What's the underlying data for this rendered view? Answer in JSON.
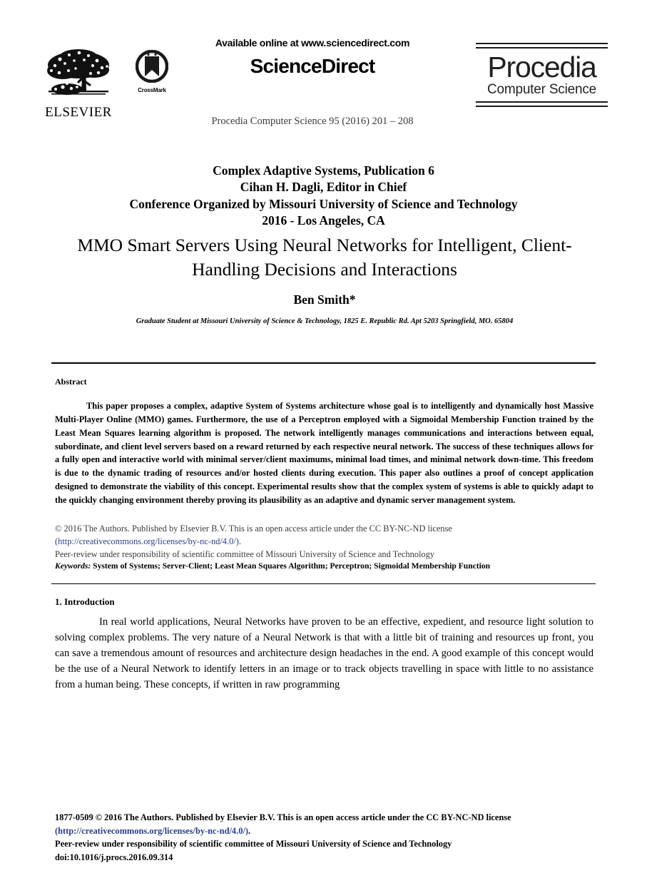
{
  "masthead": {
    "elsevier_wordmark": "ELSEVIER",
    "crossmark_label": "CrossMark",
    "available_online": "Available online at www.sciencedirect.com",
    "sciencedirect_wordmark": "ScienceDirect",
    "journal_reference": "Procedia Computer Science 95 (2016) 201 – 208",
    "procedia_title": "Procedia",
    "procedia_subtitle": "Computer Science"
  },
  "conference": {
    "line1": "Complex Adaptive Systems, Publication 6",
    "line2": "Cihan H. Dagli, Editor in Chief",
    "line3": "Conference Organized by Missouri University of Science and Technology",
    "line4": "2016 - Los Angeles, CA"
  },
  "article": {
    "title": "MMO Smart Servers Using Neural Networks for Intelligent, Client-Handling Decisions and Interactions",
    "author": "Ben Smith*",
    "affiliation": "Graduate Student at Missouri University of Science & Technology, 1825 E. Republic Rd. Apt 5203 Springfield, MO. 65804"
  },
  "abstract": {
    "heading": "Abstract",
    "body": "This paper proposes a complex, adaptive System of Systems architecture whose goal is to intelligently and dynamically host Massive Multi-Player Online (MMO) games. Furthermore, the use of a Perceptron employed with a Sigmoidal Membership Function trained by the Least Mean Squares learning algorithm is proposed. The network intelligently manages communications and interactions between equal, subordinate, and client level servers based on a reward returned by each respective neural network. The success of these techniques allows for a fully open and interactive world with minimal server/client maximums, minimal load times, and minimal network down-time. This freedom is due to the dynamic trading of resources and/or hosted clients during execution. This paper also outlines a proof of concept application designed to demonstrate the viability of this concept. Experimental results show that the complex system of systems is able to quickly adapt to the quickly changing environment thereby proving its plausibility as an adaptive and dynamic server management system."
  },
  "license": {
    "line1": "© 2016 The Authors. Published by Elsevier B.V. This is an open access article under the CC BY-NC-ND license",
    "url": "(http://creativecommons.org/licenses/by-nc-nd/4.0/)",
    "url_suffix": ".",
    "peer_review": "Peer-review under responsibility of scientific committee of Missouri University of Science and Technology"
  },
  "keywords": {
    "label": "Keywords:",
    "values": " System of Systems; Server-Client; Least Mean Squares Algorithm; Perceptron; Sigmoidal Membership Function"
  },
  "section_intro": {
    "heading": "1. Introduction",
    "body": "In real world applications, Neural Networks have proven to be an effective, expedient, and resource light solution to solving complex problems. The very nature of a Neural Network is that with a little bit of training and resources up front, you can save a tremendous amount of resources and architecture design headaches in the end. A good example of this concept would be the use of a Neural Network to identify letters in an image or to track objects travelling in space with little to no assistance from a human being. These concepts, if written in raw programming"
  },
  "footer": {
    "line1": "1877-0509 © 2016 The Authors. Published by Elsevier B.V. This is an open access article under the CC BY-NC-ND license",
    "url": "(http://creativecommons.org/licenses/by-nc-nd/4.0/)",
    "url_suffix": ".",
    "peer_review": "Peer-review under responsibility of scientific committee of Missouri University of Science and Technology",
    "doi": "doi:10.1016/j.procs.2016.09.314"
  },
  "colors": {
    "link": "#2b3f8c",
    "text": "#000000",
    "muted": "#3b3b3b"
  }
}
